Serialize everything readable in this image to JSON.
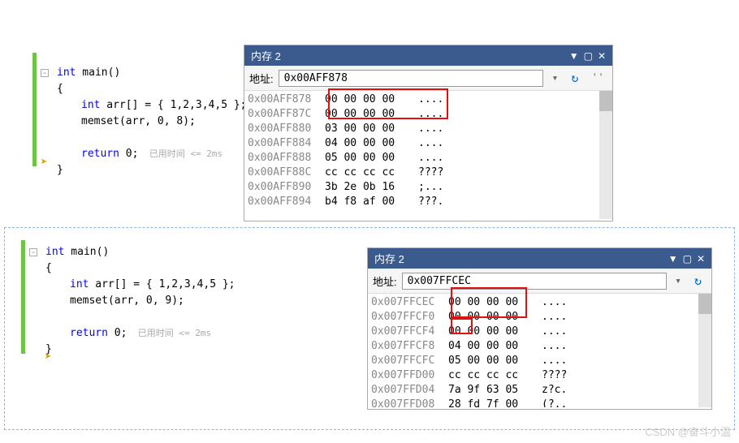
{
  "section1": {
    "code": {
      "line1_kw": "int",
      "line1_rest": " main()",
      "line2": "{",
      "line3_kw": "int",
      "line3_rest": " arr[] = { 1,2,3,4,5 };",
      "line4": "memset(arr, 0, 8);",
      "line5_kw": "return",
      "line5_rest": " 0;",
      "line5_hint": "  已用时间 <= 2ms",
      "line6": "}"
    },
    "memory": {
      "title": "内存 2",
      "addr_label": "地址:",
      "addr_value": "0x00AFF878",
      "rows": [
        {
          "addr": "0x00AFF878",
          "hex": "00 00 00 00",
          "ascii": "...."
        },
        {
          "addr": "0x00AFF87C",
          "hex": "00 00 00 00",
          "ascii": "...."
        },
        {
          "addr": "0x00AFF880",
          "hex": "03 00 00 00",
          "ascii": "...."
        },
        {
          "addr": "0x00AFF884",
          "hex": "04 00 00 00",
          "ascii": "...."
        },
        {
          "addr": "0x00AFF888",
          "hex": "05 00 00 00",
          "ascii": "...."
        },
        {
          "addr": "0x00AFF88C",
          "hex": "cc cc cc cc",
          "ascii": "????"
        },
        {
          "addr": "0x00AFF890",
          "hex": "3b 2e 0b 16",
          "ascii": ";..."
        },
        {
          "addr": "0x00AFF894",
          "hex": "b4 f8 af 00",
          "ascii": "???."
        }
      ]
    }
  },
  "section2": {
    "code": {
      "line1_kw": "int",
      "line1_rest": " main()",
      "line2": "{",
      "line3_kw": "int",
      "line3_rest": " arr[] = { 1,2,3,4,5 };",
      "line4": "memset(arr, 0, 9);",
      "line5_kw": "return",
      "line5_rest": " 0;",
      "line5_hint": "  已用时间 <= 2ms",
      "line6": "}"
    },
    "memory": {
      "title": "内存 2",
      "addr_label": "地址:",
      "addr_value": "0x007FFCEC",
      "rows": [
        {
          "addr": "0x007FFCEC",
          "hex": "00 00 00 00",
          "ascii": "...."
        },
        {
          "addr": "0x007FFCF0",
          "hex": "00 00 00 00",
          "ascii": "...."
        },
        {
          "addr": "0x007FFCF4",
          "hex": "00 00 00 00",
          "ascii": "...."
        },
        {
          "addr": "0x007FFCF8",
          "hex": "04 00 00 00",
          "ascii": "...."
        },
        {
          "addr": "0x007FFCFC",
          "hex": "05 00 00 00",
          "ascii": "...."
        },
        {
          "addr": "0x007FFD00",
          "hex": "cc cc cc cc",
          "ascii": "????"
        },
        {
          "addr": "0x007FFD04",
          "hex": "7a 9f 63 05",
          "ascii": "z?c."
        },
        {
          "addr": "0x007FFD08",
          "hex": "28 fd 7f 00",
          "ascii": "(?.."
        }
      ]
    }
  },
  "watermark": "CSDN @奋斗小温"
}
